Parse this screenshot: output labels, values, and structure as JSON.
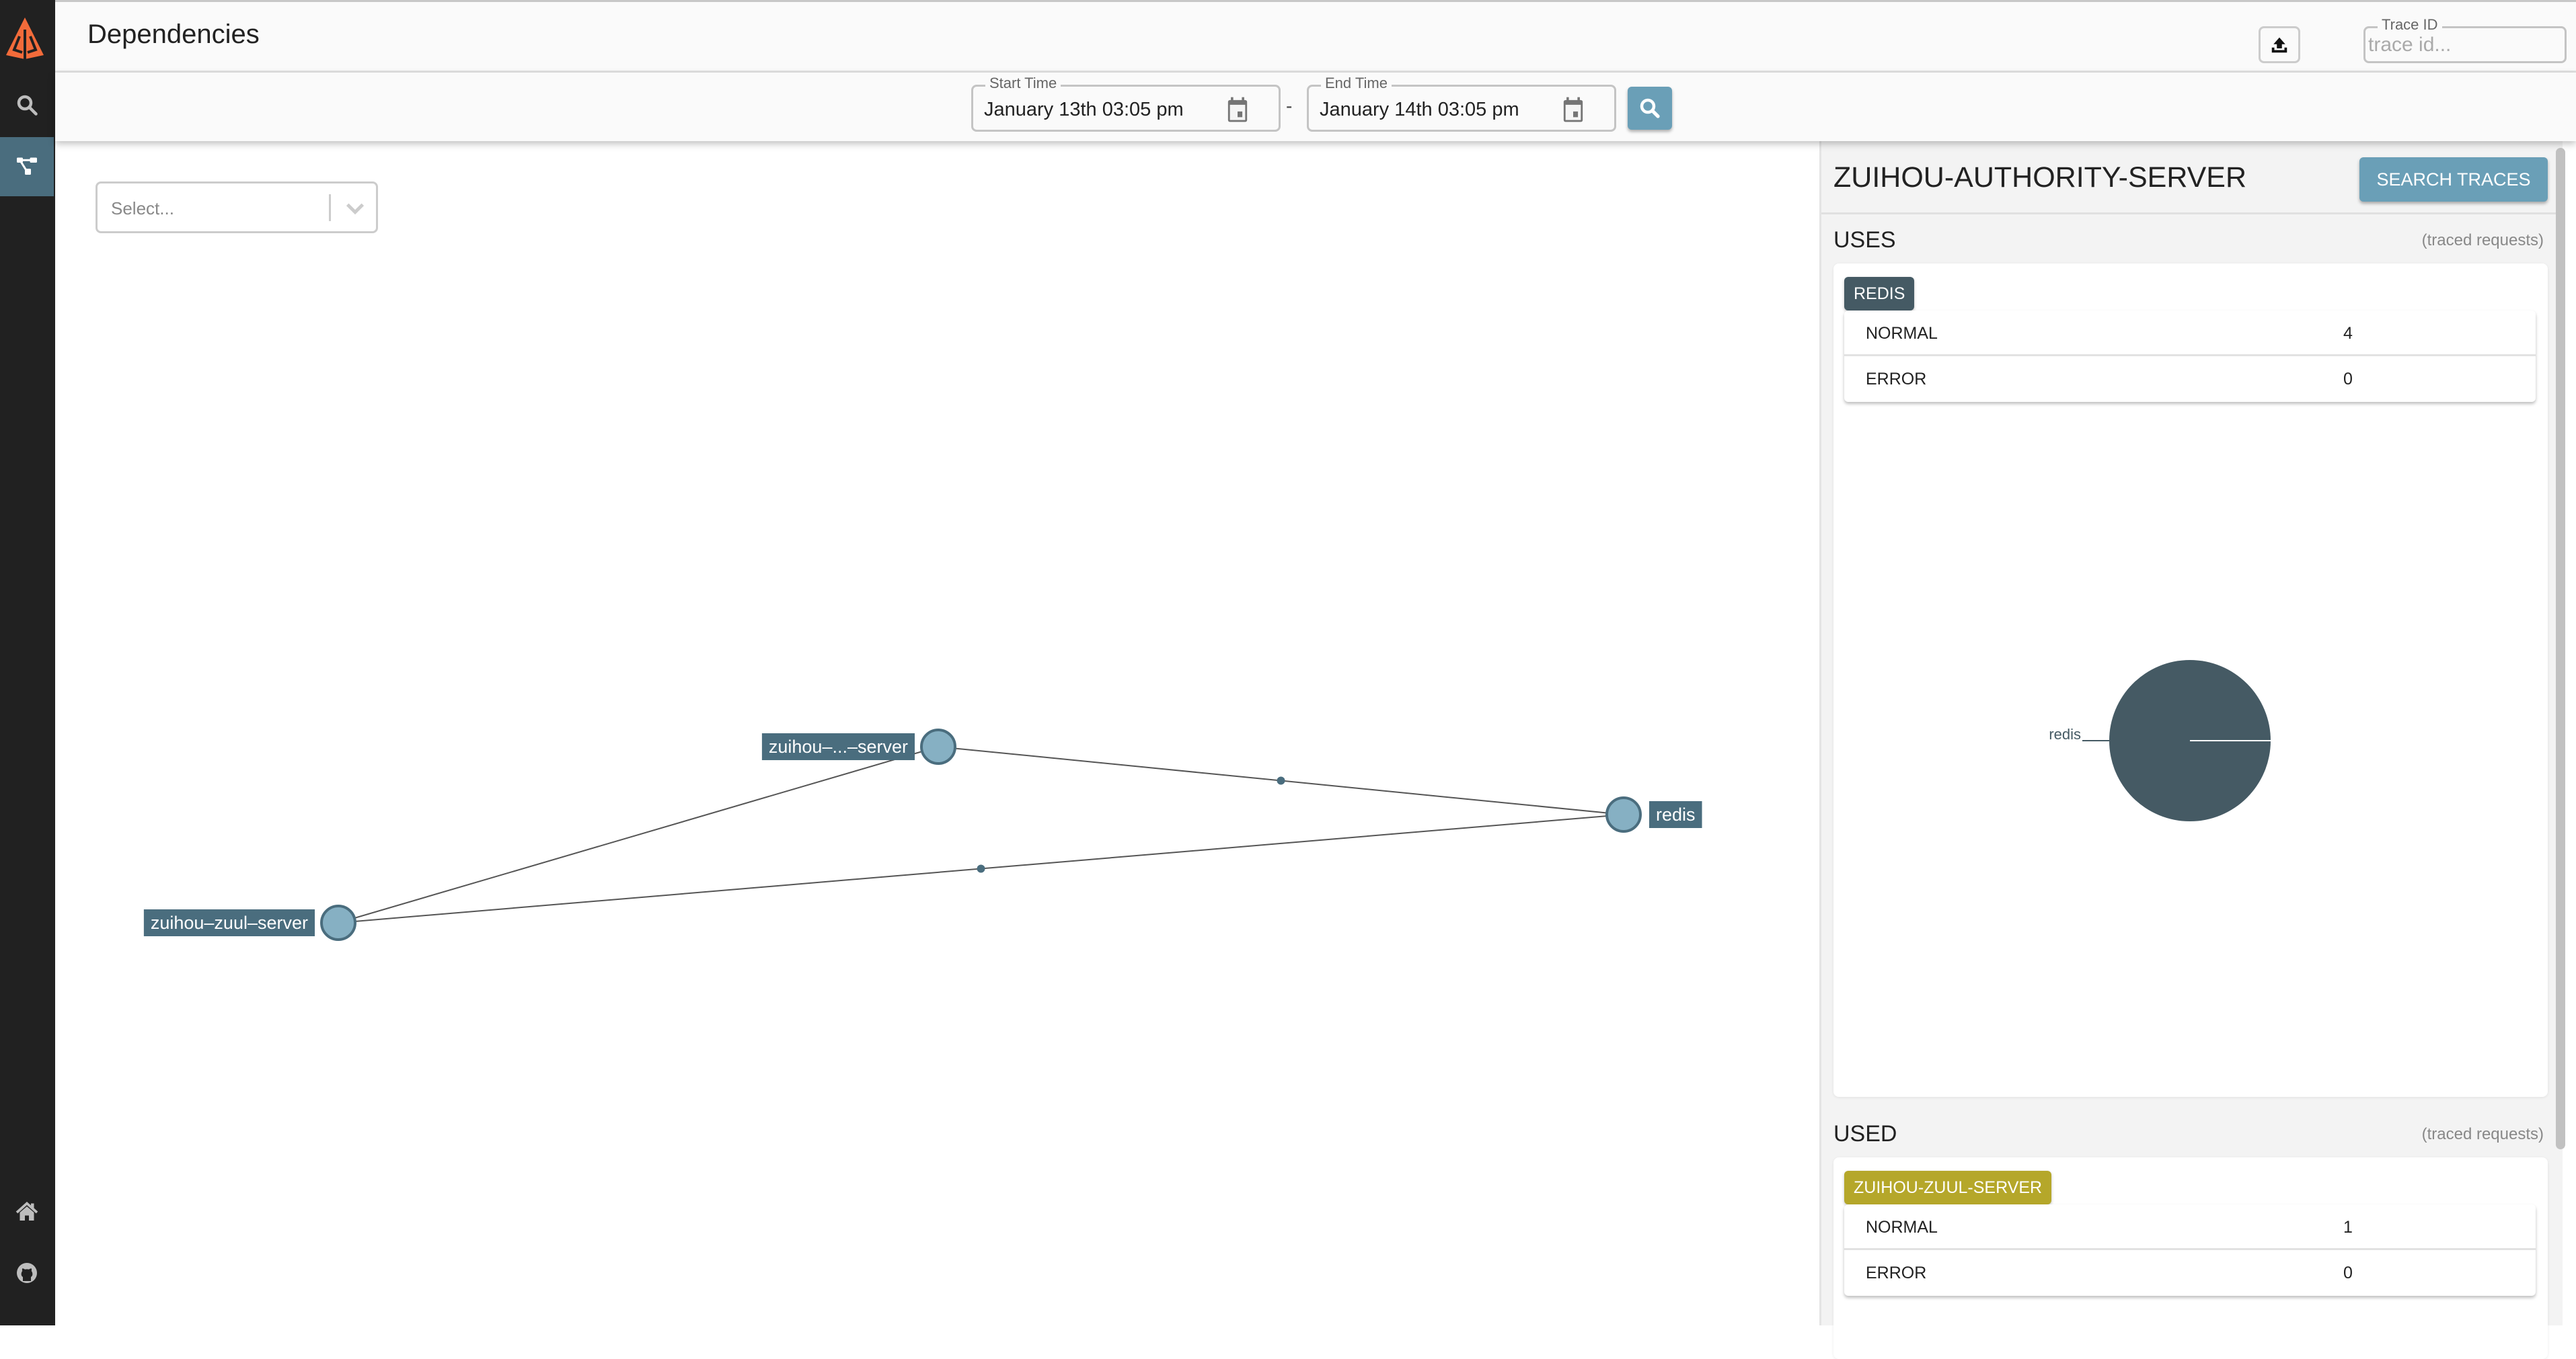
{
  "app": {
    "page_title": "Dependencies",
    "brand_color": "#f26b3a",
    "accent_color": "#6a9fb7"
  },
  "sidebar": {
    "items": [
      {
        "name": "logo",
        "icon": "zipkin-logo-icon"
      },
      {
        "name": "search",
        "icon": "search-icon",
        "active": false
      },
      {
        "name": "dependencies",
        "icon": "dependencies-icon",
        "active": true
      },
      {
        "name": "home",
        "icon": "home-icon"
      },
      {
        "name": "github",
        "icon": "github-icon"
      }
    ]
  },
  "topbar": {
    "upload_icon": "upload-icon",
    "trace_id": {
      "label": "Trace ID",
      "placeholder": "trace id...",
      "value": ""
    }
  },
  "filters": {
    "start_time": {
      "label": "Start Time",
      "value": "January 13th 03:05 pm"
    },
    "separator": "-",
    "end_time": {
      "label": "End Time",
      "value": "January 14th 03:05 pm"
    },
    "search_icon": "search-icon"
  },
  "graph": {
    "select": {
      "placeholder": "Select..."
    },
    "nodes": [
      {
        "id": "zuihou-authority-server",
        "label": "zuihou–...–server",
        "selected": true
      },
      {
        "id": "zuihou-zuul-server",
        "label": "zuihou–zuul–server"
      },
      {
        "id": "redis",
        "label": "redis"
      }
    ],
    "edges": [
      {
        "from": "zuihou-zuul-server",
        "to": "zuihou-authority-server"
      },
      {
        "from": "zuihou-authority-server",
        "to": "redis"
      },
      {
        "from": "zuihou-zuul-server",
        "to": "redis"
      }
    ]
  },
  "panel": {
    "title": "ZUIHOU-AUTHORITY-SERVER",
    "search_traces_label": "SEARCH TRACES",
    "uses": {
      "title": "USES",
      "note": "(traced requests)",
      "items": [
        {
          "name": "REDIS",
          "color": "#455a64",
          "normal_label": "NORMAL",
          "normal": "4",
          "error_label": "ERROR",
          "error": "0"
        }
      ]
    },
    "used": {
      "title": "USED",
      "note": "(traced requests)",
      "items": [
        {
          "name": "ZUIHOU-ZUUL-SERVER",
          "color": "#b5a72a",
          "normal_label": "NORMAL",
          "normal": "1",
          "error_label": "ERROR",
          "error": "0"
        }
      ]
    }
  },
  "chart_data": {
    "type": "pie",
    "title": "",
    "slices": [
      {
        "label": "redis",
        "value": 4,
        "color": "#455a64"
      }
    ]
  }
}
